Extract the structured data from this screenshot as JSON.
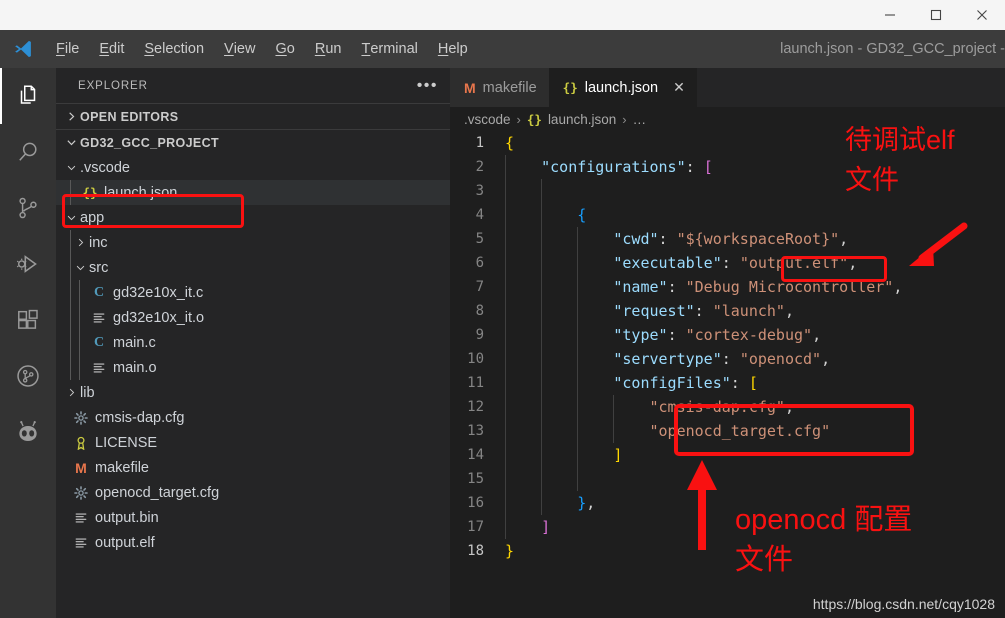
{
  "window": {
    "title": "launch.json - GD32_GCC_project -",
    "controls": [
      {
        "name": "minimize-button",
        "glyph": "minimize"
      },
      {
        "name": "maximize-button",
        "glyph": "maximize"
      },
      {
        "name": "close-button",
        "glyph": "close"
      }
    ]
  },
  "menubar": {
    "logo": "vscode-logo",
    "items": [
      {
        "label": "File",
        "mnemonic": "F"
      },
      {
        "label": "Edit",
        "mnemonic": "E"
      },
      {
        "label": "Selection",
        "mnemonic": "S"
      },
      {
        "label": "View",
        "mnemonic": "V"
      },
      {
        "label": "Go",
        "mnemonic": "G"
      },
      {
        "label": "Run",
        "mnemonic": "R"
      },
      {
        "label": "Terminal",
        "mnemonic": "T"
      },
      {
        "label": "Help",
        "mnemonic": "H"
      }
    ]
  },
  "activitybar": {
    "items": [
      {
        "icon": "files-explorer-icon",
        "label": "Explorer",
        "active": true
      },
      {
        "icon": "search-icon",
        "label": "Search",
        "active": false
      },
      {
        "icon": "source-control-icon",
        "label": "Source Control",
        "active": false
      },
      {
        "icon": "run-and-debug-icon",
        "label": "Run and Debug",
        "active": false
      },
      {
        "icon": "extensions-icon",
        "label": "Extensions",
        "active": false
      },
      {
        "icon": "gitlens-icon",
        "label": "GitLens",
        "active": false
      },
      {
        "icon": "platformio-ant-icon",
        "label": "PlatformIO",
        "active": false
      }
    ]
  },
  "sidebar": {
    "title": "EXPLORER",
    "more_actions": "•••",
    "sections": [
      {
        "label": "OPEN EDITORS",
        "expanded": false
      },
      {
        "label": "GD32_GCC_PROJECT",
        "expanded": true
      }
    ],
    "tree": [
      {
        "label": ".vscode",
        "depth": 1,
        "kind": "folder",
        "expanded": true,
        "icon": "chevron-down-icon",
        "selected": false
      },
      {
        "label": "launch.json",
        "depth": 2,
        "kind": "json",
        "icon": "json-braces-icon",
        "selected": true
      },
      {
        "label": "app",
        "depth": 1,
        "kind": "folder",
        "expanded": true,
        "icon": "chevron-down-icon",
        "selected": false
      },
      {
        "label": "inc",
        "depth": 2,
        "kind": "folder",
        "expanded": false,
        "icon": "chevron-right-icon",
        "selected": false
      },
      {
        "label": "src",
        "depth": 2,
        "kind": "folder",
        "expanded": true,
        "icon": "chevron-down-icon",
        "selected": false
      },
      {
        "label": "gd32e10x_it.c",
        "depth": 3,
        "kind": "c",
        "icon": "c-file-icon",
        "selected": false
      },
      {
        "label": "gd32e10x_it.o",
        "depth": 3,
        "kind": "obj",
        "icon": "plain-file-icon",
        "selected": false
      },
      {
        "label": "main.c",
        "depth": 3,
        "kind": "c",
        "icon": "c-file-icon",
        "selected": false
      },
      {
        "label": "main.o",
        "depth": 3,
        "kind": "obj",
        "icon": "plain-file-icon",
        "selected": false
      },
      {
        "label": "lib",
        "depth": 1,
        "kind": "folder",
        "expanded": false,
        "icon": "chevron-right-icon",
        "selected": false
      },
      {
        "label": "cmsis-dap.cfg",
        "depth": 1,
        "kind": "cfg",
        "icon": "gear-icon",
        "selected": false
      },
      {
        "label": "LICENSE",
        "depth": 1,
        "kind": "license",
        "icon": "license-ribbon-icon",
        "selected": false
      },
      {
        "label": "makefile",
        "depth": 1,
        "kind": "make",
        "icon": "makefile-m-icon",
        "selected": false
      },
      {
        "label": "openocd_target.cfg",
        "depth": 1,
        "kind": "cfg",
        "icon": "gear-icon",
        "selected": false
      },
      {
        "label": "output.bin",
        "depth": 1,
        "kind": "obj",
        "icon": "plain-file-icon",
        "selected": false
      },
      {
        "label": "output.elf",
        "depth": 1,
        "kind": "obj",
        "icon": "plain-file-icon",
        "selected": false
      }
    ]
  },
  "editor": {
    "tabs": [
      {
        "label": "makefile",
        "icon": "makefile-m-icon",
        "active": false,
        "closable": false
      },
      {
        "label": "launch.json",
        "icon": "json-braces-icon",
        "active": true,
        "closable": true,
        "close": "✕"
      }
    ],
    "breadcrumb": [
      {
        "label": ".vscode",
        "icon": null
      },
      {
        "label": "launch.json",
        "icon": "json-braces-icon"
      },
      {
        "label": "…",
        "icon": null
      }
    ],
    "breadcrumb_separator": "›",
    "lines": [
      {
        "n": 1,
        "indent": 0,
        "text": "{"
      },
      {
        "n": 2,
        "indent": 0,
        "text": "    \"configurations\": ["
      },
      {
        "n": 3,
        "indent": 0,
        "text": ""
      },
      {
        "n": 4,
        "indent": 0,
        "text": "        {"
      },
      {
        "n": 5,
        "indent": 0,
        "text": "            \"cwd\": \"${workspaceRoot}\","
      },
      {
        "n": 6,
        "indent": 0,
        "text": "            \"executable\": \"output.elf\","
      },
      {
        "n": 7,
        "indent": 0,
        "text": "            \"name\": \"Debug Microcontroller\","
      },
      {
        "n": 8,
        "indent": 0,
        "text": "            \"request\": \"launch\","
      },
      {
        "n": 9,
        "indent": 0,
        "text": "            \"type\": \"cortex-debug\","
      },
      {
        "n": 10,
        "indent": 0,
        "text": "            \"servertype\": \"openocd\","
      },
      {
        "n": 11,
        "indent": 0,
        "text": "            \"configFiles\": ["
      },
      {
        "n": 12,
        "indent": 0,
        "text": "                \"cmsis-dap.cfg\","
      },
      {
        "n": 13,
        "indent": 0,
        "text": "                \"openocd_target.cfg\""
      },
      {
        "n": 14,
        "indent": 0,
        "text": "            ]"
      },
      {
        "n": 15,
        "indent": 0,
        "text": ""
      },
      {
        "n": 16,
        "indent": 0,
        "text": "        },"
      },
      {
        "n": 17,
        "indent": 0,
        "text": "    ]"
      },
      {
        "n": 18,
        "indent": 0,
        "text": "}"
      }
    ]
  },
  "annotations": {
    "color": "#f91111",
    "elf_note_line1": "待调试elf",
    "elf_note_line2": "文件",
    "openocd_note_line1": "openocd 配置",
    "openocd_note_line2": "文件",
    "watermark": "https://blog.csdn.net/cqy1028"
  }
}
